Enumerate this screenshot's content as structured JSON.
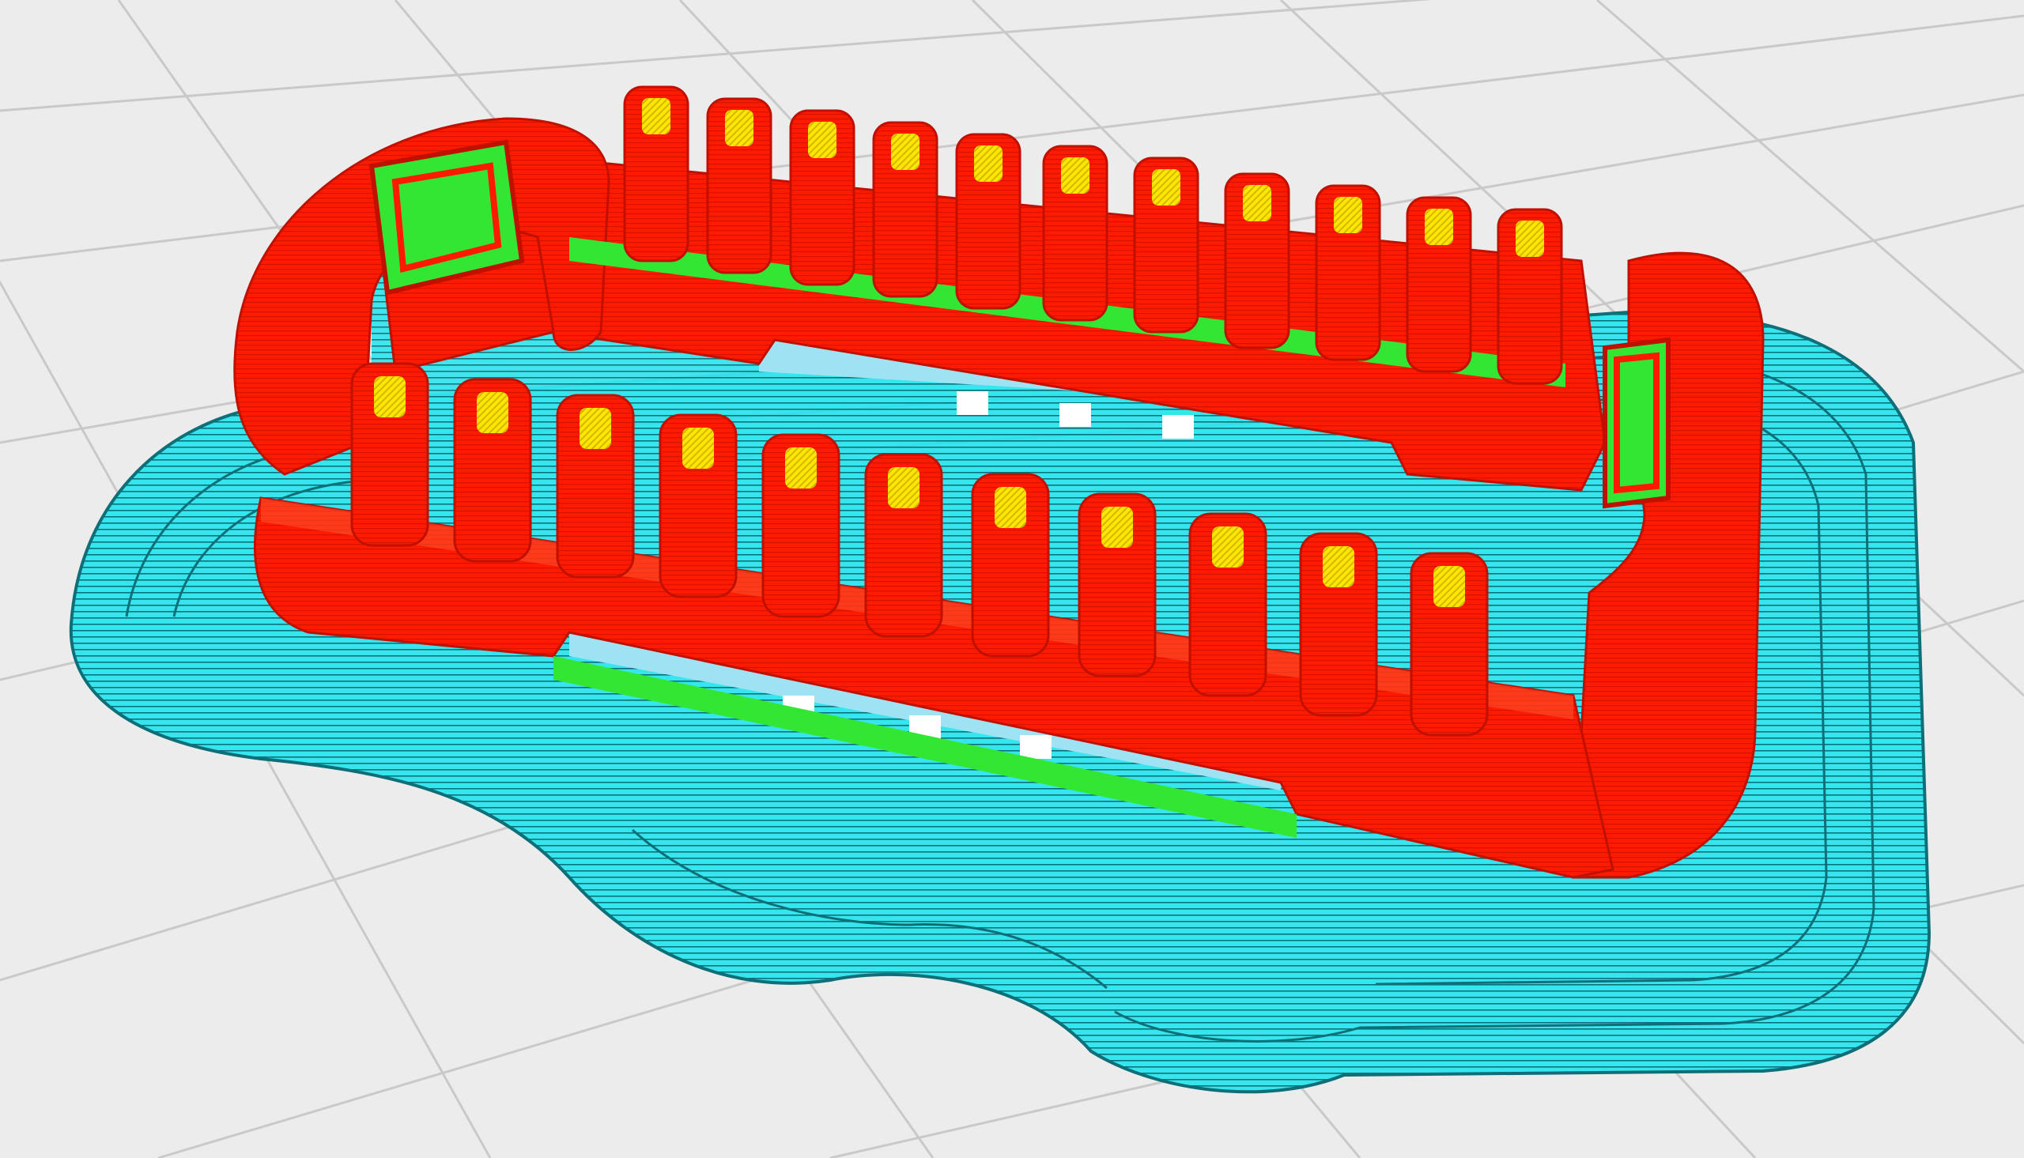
{
  "viewport": {
    "view": "layer-view",
    "colors": {
      "background": "#ececec",
      "grid_line": "#c9c9c9",
      "wall_outer": "#ff1a00",
      "wall_inner": "#33e633",
      "top_infill": "#ffe600",
      "brim_support": "#36e6ee",
      "brim_dark": "#0f6f78"
    }
  }
}
